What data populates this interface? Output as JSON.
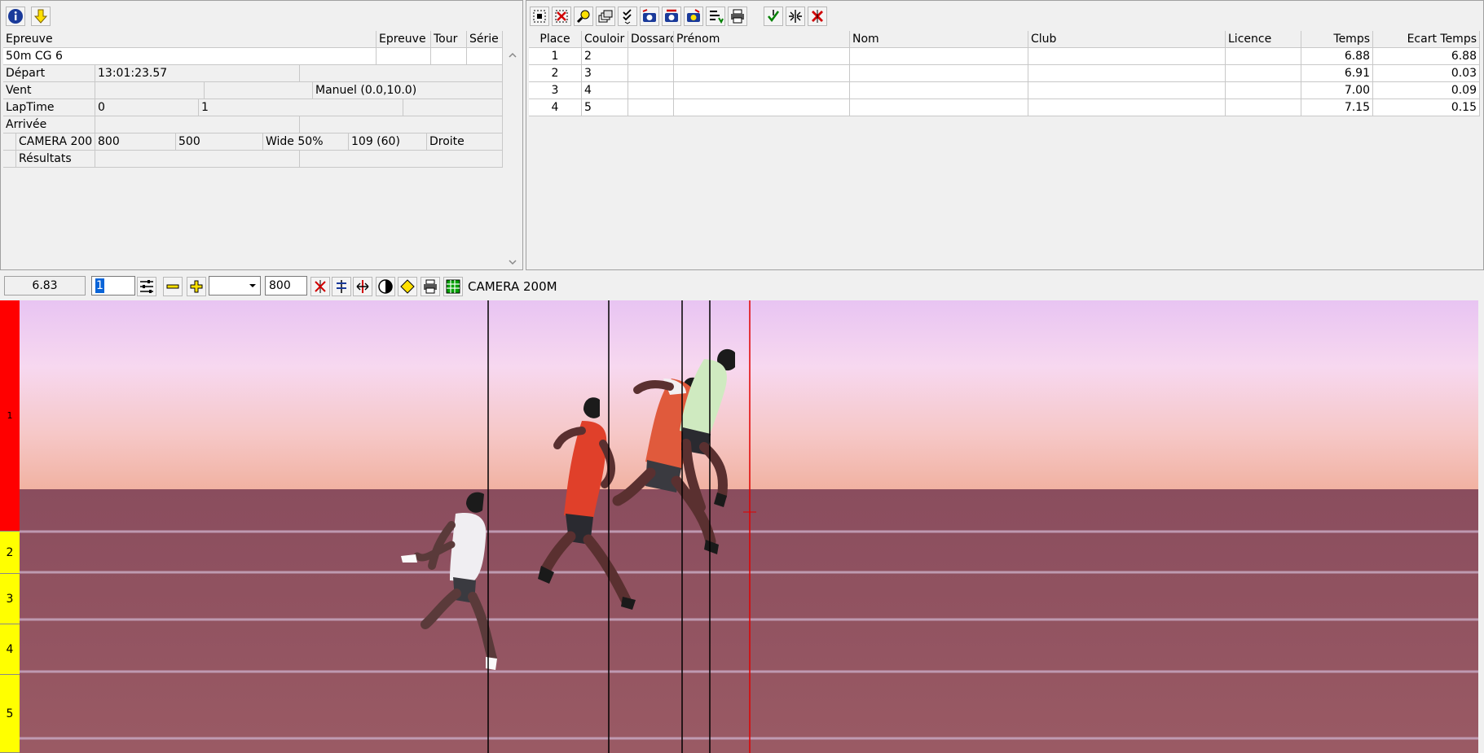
{
  "event_panel": {
    "headers": {
      "epreuve": "Epreuve",
      "epreuve_n": "Epreuve n",
      "tour": "Tour",
      "serie": "Série"
    },
    "event_name": "50m CG 6",
    "rows": {
      "depart": {
        "label": "Départ",
        "value": "13:01:23.57"
      },
      "vent": {
        "label": "Vent",
        "value": "Manuel (0.0,10.0)"
      },
      "laptime": {
        "label": "LapTime",
        "v1": "0",
        "v2": "1"
      },
      "arrivee": {
        "label": "Arrivée"
      },
      "camera": {
        "label": "CAMERA 200",
        "c1": "800",
        "c2": "500",
        "c3": "Wide 50%",
        "c4": "109  (60)",
        "c5": "Droite"
      },
      "resultats": {
        "label": "Résultats"
      }
    }
  },
  "results": {
    "columns": {
      "place": "Place",
      "couloir": "Couloir",
      "dossard": "Dossard",
      "prenom": "Prénom",
      "nom": "Nom",
      "club": "Club",
      "licence": "Licence",
      "temps": "Temps",
      "ecart": "Ecart Temps"
    },
    "rows": [
      {
        "place": "1",
        "couloir": "2",
        "temps": "6.88",
        "ecart": "6.88"
      },
      {
        "place": "2",
        "couloir": "3",
        "temps": "6.91",
        "ecart": "0.03"
      },
      {
        "place": "3",
        "couloir": "4",
        "temps": "7.00",
        "ecart": "0.09"
      },
      {
        "place": "4",
        "couloir": "5",
        "temps": "7.15",
        "ecart": "0.15"
      }
    ]
  },
  "viewer": {
    "time_readout": "6.83",
    "frame_value": "1",
    "zoom_value": "800",
    "camera_label": "CAMERA 200M",
    "lanes": [
      "1",
      "2",
      "3",
      "4",
      "5"
    ]
  },
  "colors": {
    "lane1": "#ff0000",
    "lanes_other": "#ffff00",
    "cursor": "#e00000",
    "track": "#8e4f5a",
    "sky": "#f6d2f0"
  }
}
